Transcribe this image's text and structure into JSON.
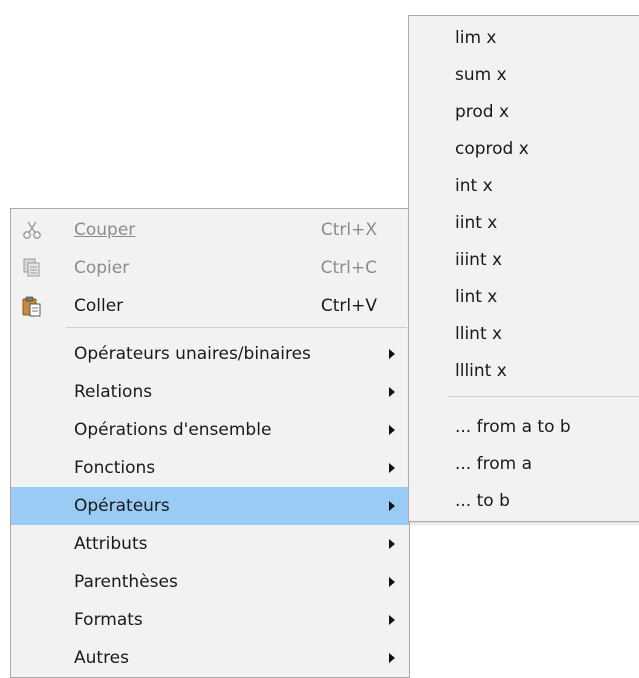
{
  "main_menu": {
    "items": [
      {
        "label": "Couper",
        "shortcut": "Ctrl+X",
        "disabled": true,
        "icon": "scissors-icon"
      },
      {
        "label": "Copier",
        "shortcut": "Ctrl+C",
        "disabled": true,
        "icon": "copy-icon"
      },
      {
        "label": "Coller",
        "shortcut": "Ctrl+V",
        "disabled": false,
        "icon": "paste-icon"
      },
      {
        "label": "Opérateurs unaires/binaires",
        "submenu": true
      },
      {
        "label": "Relations",
        "submenu": true
      },
      {
        "label": "Opérations d'ensemble",
        "submenu": true
      },
      {
        "label": "Fonctions",
        "submenu": true
      },
      {
        "label": "Opérateurs",
        "submenu": true,
        "highlighted": true
      },
      {
        "label": "Attributs",
        "submenu": true
      },
      {
        "label": "Parenthèses",
        "submenu": true
      },
      {
        "label": "Formats",
        "submenu": true
      },
      {
        "label": "Autres",
        "submenu": true
      }
    ],
    "highlight_color": "#99cbf5"
  },
  "sub_menu": {
    "items": [
      {
        "label": "lim x"
      },
      {
        "label": "sum x"
      },
      {
        "label": "prod x"
      },
      {
        "label": "coprod x"
      },
      {
        "label": "int x"
      },
      {
        "label": "iint x"
      },
      {
        "label": "iiint x"
      },
      {
        "label": "lint x"
      },
      {
        "label": "llint x"
      },
      {
        "label": "lllint x"
      },
      {
        "label": "... from a to b"
      },
      {
        "label": "... from a"
      },
      {
        "label": "... to b"
      }
    ]
  }
}
